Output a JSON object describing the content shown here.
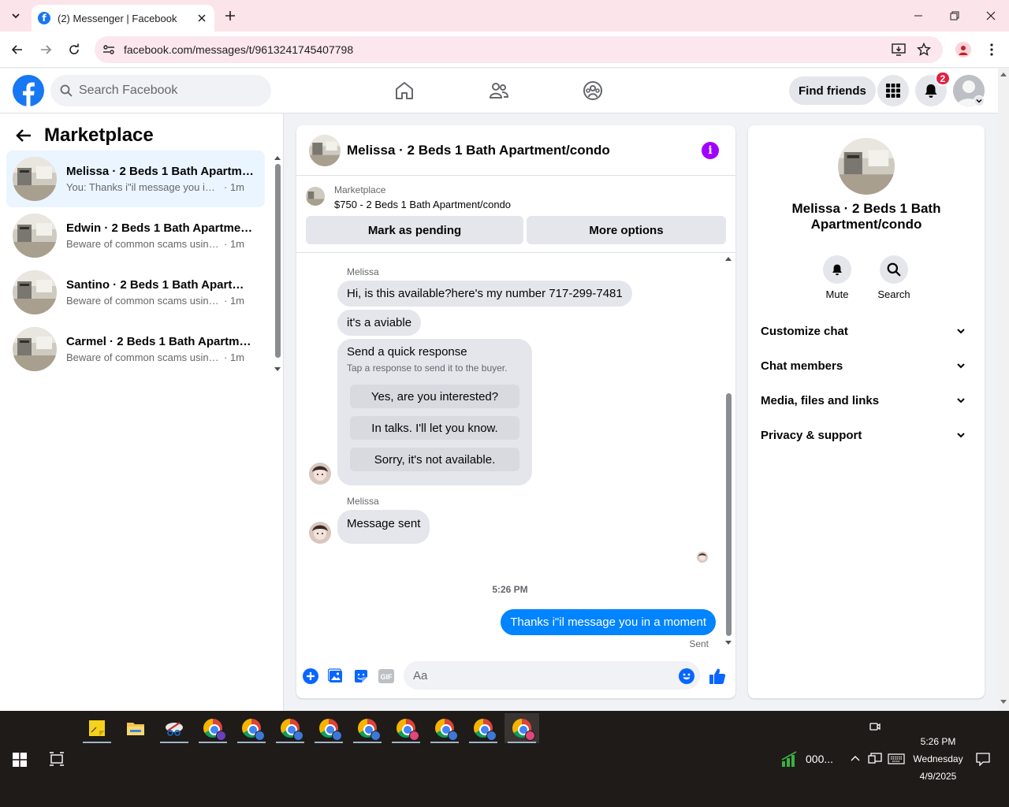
{
  "browser": {
    "tab_title": "(2) Messenger | Facebook",
    "url": "facebook.com/messages/t/9613241745407798"
  },
  "fb_nav": {
    "search_placeholder": "Search Facebook",
    "find_friends": "Find friends",
    "notification_count": "2",
    "brand_color": "#1877f2"
  },
  "left": {
    "title": "Marketplace",
    "conversations": [
      {
        "name": "Melissa · 2 Beds 1 Bath Apartme...",
        "preview": "You: Thanks i\"il message you in a ...",
        "time": "· 1m",
        "active": true
      },
      {
        "name": "Edwin · 2 Beds 1 Bath Apartment...",
        "preview": "Beware of common scams using p...",
        "time": "· 1m"
      },
      {
        "name": "Santino · 2 Beds 1 Bath Apartme...",
        "preview": "Beware of common scams using p...",
        "time": "· 1m"
      },
      {
        "name": "Carmel · 2 Beds 1 Bath Apartme...",
        "preview": "Beware of common scams using p...",
        "time": "· 1m"
      }
    ]
  },
  "chat": {
    "title": "Melissa · 2 Beds 1 Bath Apartment/condo",
    "marketplace_label": "Marketplace",
    "listing": "$750 - 2 Beds 1 Bath Apartment/condo",
    "mark_pending": "Mark as pending",
    "more_options": "More options",
    "sender_1": "Melissa",
    "msg_1": "Hi, is this available?here's my number 717-299-7481",
    "msg_2": "it's a aviable",
    "quick_title": "Send a quick response",
    "quick_sub": "Tap a response to send it to the buyer.",
    "quick_options": [
      "Yes, are you interested?",
      "In talks. I'll let you know.",
      "Sorry, it's not available."
    ],
    "sender_2": "Melissa",
    "msg_3": "Message sent",
    "timestamp": "5:26 PM",
    "outgoing": "Thanks i\"il message you in a moment",
    "sent_label": "Sent",
    "composer_placeholder": "Aa",
    "outgoing_color": "#0084ff",
    "info_color": "#a100ff"
  },
  "right": {
    "name": "Melissa · 2 Beds 1 Bath Apartment/condo",
    "mute": "Mute",
    "search": "Search",
    "sections": [
      "Customize chat",
      "Chat members",
      "Media, files and links",
      "Privacy & support"
    ]
  },
  "taskbar": {
    "network_label": "000...",
    "time": "5:26 PM",
    "day": "Wednesday",
    "date": "4/9/2025"
  }
}
